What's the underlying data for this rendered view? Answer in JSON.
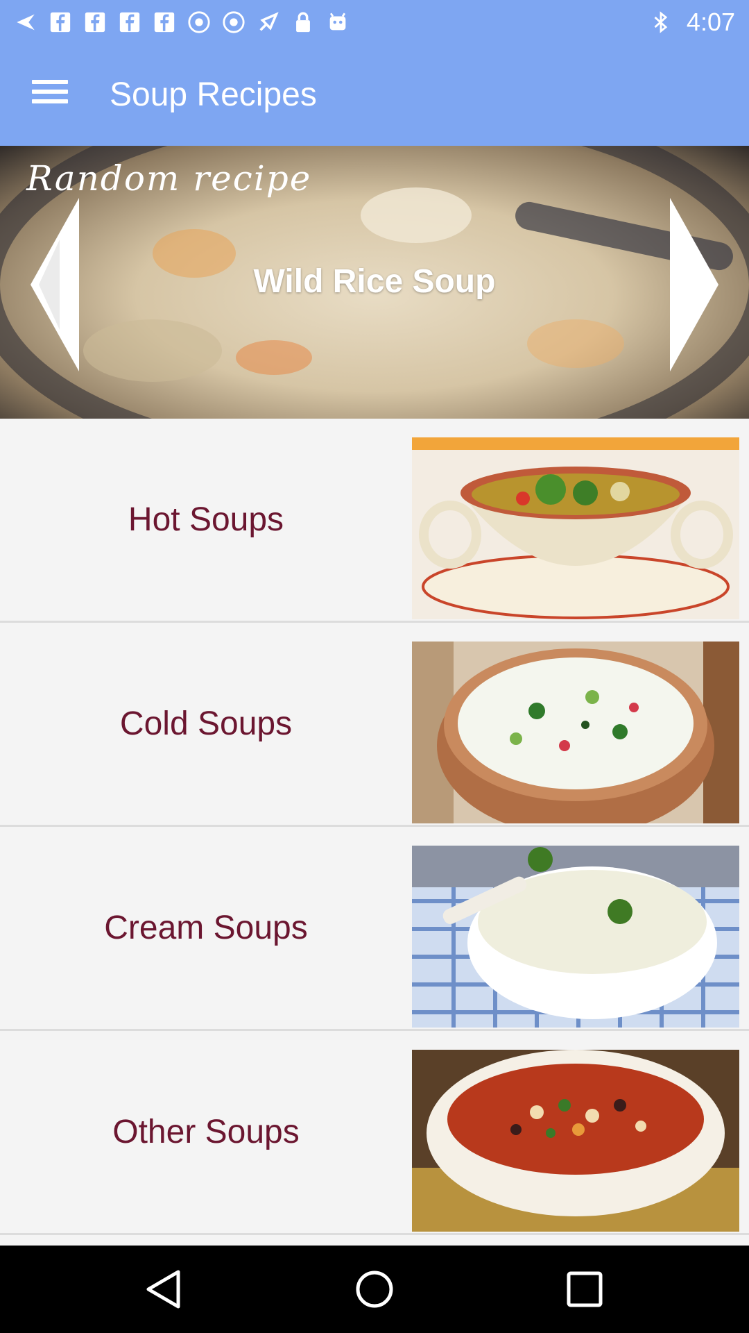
{
  "status_bar": {
    "time": "4:07",
    "left_icons": [
      "back-arrow-icon",
      "facebook-icon",
      "facebook-icon",
      "facebook-icon",
      "facebook-icon",
      "record-icon",
      "record-icon",
      "fake-gps-icon",
      "lock-icon",
      "android-icon"
    ],
    "right_icons": [
      "bluetooth-icon"
    ]
  },
  "app_bar": {
    "title": "Soup Recipes",
    "background": "#7ea6f2"
  },
  "hero": {
    "tag": "Random recipe",
    "title": "Wild Rice Soup"
  },
  "categories": [
    {
      "label": "Hot Soups"
    },
    {
      "label": "Cold Soups"
    },
    {
      "label": "Cream Soups"
    },
    {
      "label": "Other Soups"
    }
  ],
  "colors": {
    "accent": "#7ea6f2",
    "category_text": "#6b1630",
    "list_background": "#f4f4f4"
  }
}
